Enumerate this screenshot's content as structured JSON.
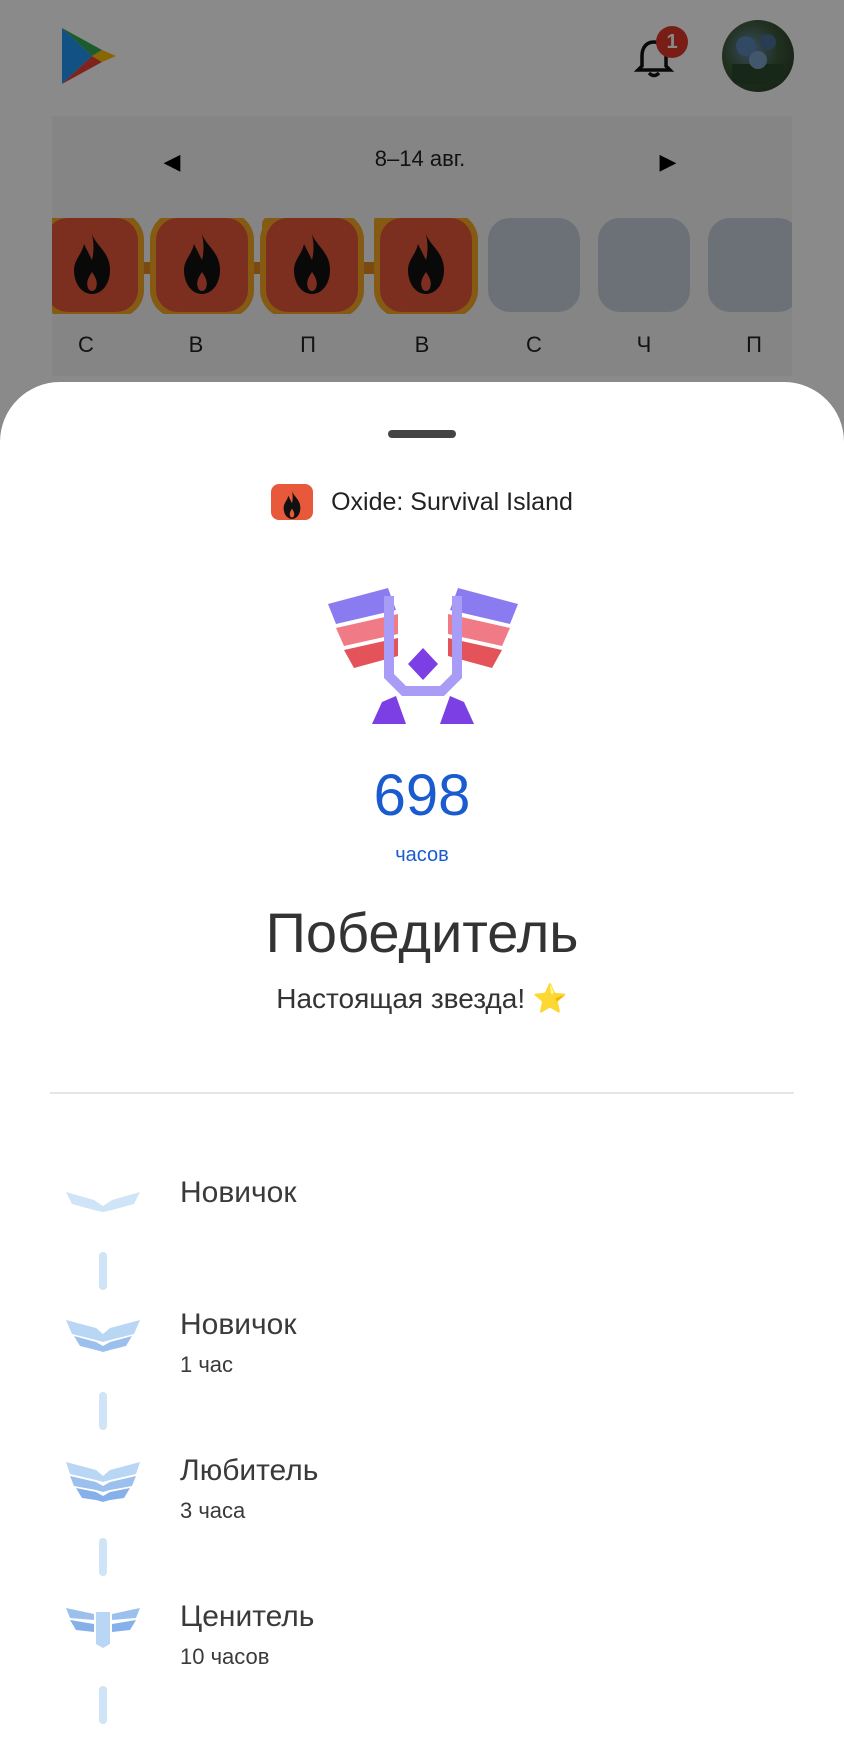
{
  "header": {
    "notification_count": "1"
  },
  "week": {
    "range_label": "8–14 авг.",
    "days": [
      {
        "letter": "С",
        "active": true
      },
      {
        "letter": "В",
        "active": true
      },
      {
        "letter": "П",
        "active": true
      },
      {
        "letter": "В",
        "active": true
      },
      {
        "letter": "С",
        "active": false
      },
      {
        "letter": "Ч",
        "active": false
      },
      {
        "letter": "П",
        "active": false
      }
    ]
  },
  "sheet": {
    "app_name": "Oxide: Survival Island",
    "hours_value": "698",
    "hours_unit": "часов",
    "level_title": "Победитель",
    "level_subtitle": "Настоящая звезда! ⭐",
    "tiers": [
      {
        "name": "Новичок",
        "hours": ""
      },
      {
        "name": "Новичок",
        "hours": "1 час"
      },
      {
        "name": "Любитель",
        "hours": "3 часа"
      },
      {
        "name": "Ценитель",
        "hours": "10 часов"
      }
    ]
  },
  "colors": {
    "accent_blue": "#1a5cd0",
    "fire": "#e8583a",
    "flame_glow": "#f5a623",
    "tier_light": "#cfe4f7"
  }
}
